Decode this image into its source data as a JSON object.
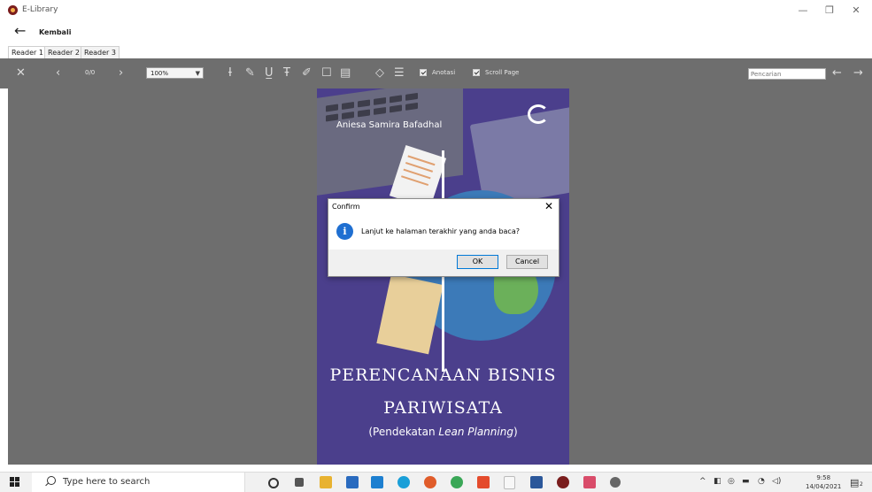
{
  "window": {
    "title": "E-Library",
    "minimize_glyph": "—",
    "restore_glyph": "❐",
    "close_glyph": "✕"
  },
  "nav": {
    "back_label": "Kembali"
  },
  "tabs": [
    {
      "label": "Reader 1",
      "active": true
    },
    {
      "label": "Reader 2",
      "active": false
    },
    {
      "label": "Reader 3",
      "active": false
    }
  ],
  "toolbar": {
    "page_counter": "0/0",
    "zoom_value": "100%",
    "annotation_label": "Anotasi",
    "annotation_checked": true,
    "scroll_page_label": "Scroll Page",
    "scroll_page_checked": true,
    "search_placeholder": "Pencarian"
  },
  "book_cover": {
    "author": "Aniesa Samira Bafadhal",
    "title_line1": "PERENCANAAN BISNIS",
    "title_line2": "PARIWISATA",
    "subtitle_prefix": "(Pendekatan ",
    "subtitle_italic": "Lean Planning",
    "subtitle_suffix": ")"
  },
  "dialog": {
    "title": "Confirm",
    "message": "Lanjut ke halaman terakhir yang anda baca?",
    "ok_label": "OK",
    "cancel_label": "Cancel"
  },
  "taskbar": {
    "search_placeholder": "Type here to search",
    "time": "9:58",
    "date": "14/04/2021",
    "notification_count": "2"
  },
  "colors": {
    "toolbar_bg": "#6e6e6e",
    "cover_bg": "#4b3f8c",
    "info_icon": "#1f6fd1",
    "ok_border": "#0078d7"
  }
}
